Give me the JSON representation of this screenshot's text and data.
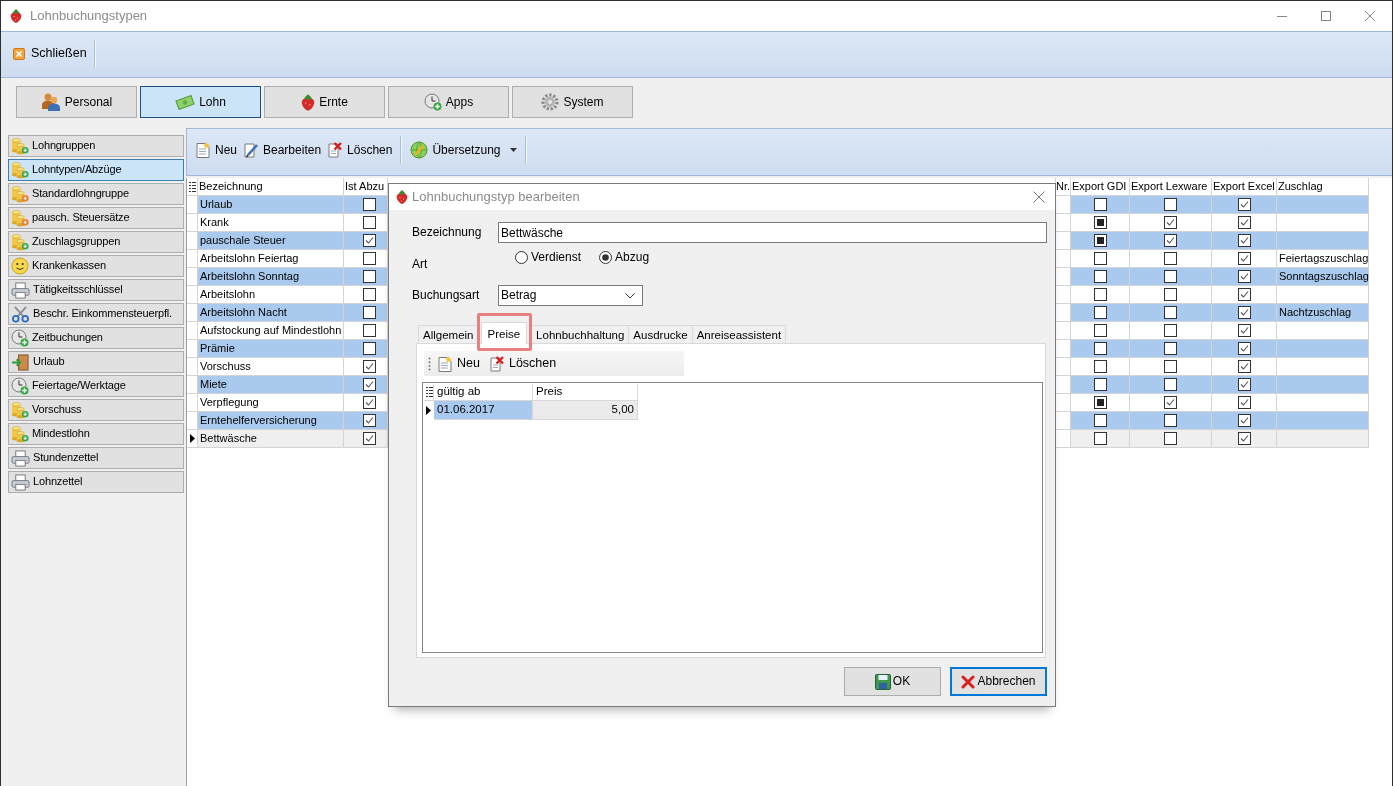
{
  "window": {
    "title": "Lohnbuchungstypen"
  },
  "toolbar": {
    "buttons": [
      {
        "label": "Schließen"
      }
    ]
  },
  "modules": [
    {
      "label": "Personal",
      "selected": false
    },
    {
      "label": "Lohn",
      "selected": true
    },
    {
      "label": "Ernte",
      "selected": false
    },
    {
      "label": "Apps",
      "selected": false
    },
    {
      "label": "System",
      "selected": false
    }
  ],
  "sidebar": {
    "items": [
      {
        "label": "Lohngruppen",
        "selected": false
      },
      {
        "label": "Lohntypen/Abzüge",
        "selected": true
      },
      {
        "label": "Standardlohngruppe",
        "selected": false
      },
      {
        "label": "pausch. Steuersätze",
        "selected": false
      },
      {
        "label": "Zuschlagsgruppen",
        "selected": false
      },
      {
        "label": "Krankenkassen",
        "selected": false
      },
      {
        "label": "Tätigkeitsschlüssel",
        "selected": false
      },
      {
        "label": "Beschr. Einkommensteuerpfl.",
        "selected": false
      },
      {
        "label": "Zeitbuchungen",
        "selected": false
      },
      {
        "label": "Urlaub",
        "selected": false
      },
      {
        "label": "Feiertage/Werktage",
        "selected": false
      },
      {
        "label": "Vorschuss",
        "selected": false
      },
      {
        "label": "Mindestlohn",
        "selected": false
      },
      {
        "label": "Stundenzettel",
        "selected": false
      },
      {
        "label": "Lohnzettel",
        "selected": false
      }
    ]
  },
  "list_toolbar": {
    "buttons": [
      {
        "label": "Neu",
        "kind": "button"
      },
      {
        "label": "Bearbeiten",
        "kind": "button"
      },
      {
        "label": "Löschen",
        "kind": "button"
      },
      {
        "label": "Übersetzung",
        "kind": "dropdown"
      }
    ]
  },
  "table": {
    "columns": [
      "Bezeichnung",
      "Ist Abzu",
      "Nr.",
      "Export GDI",
      "Export Lexware",
      "Export Excel",
      "Zuschlag"
    ],
    "rows": [
      {
        "bezeichnung": "Urlaub",
        "ist_abzug": false,
        "export_gdi": false,
        "export_gdi_indeterminate": false,
        "export_lexware": false,
        "export_excel": true,
        "selected": false
      },
      {
        "bezeichnung": "Krank",
        "ist_abzug": false,
        "export_gdi": false,
        "export_gdi_indeterminate": true,
        "export_lexware": true,
        "export_excel": true,
        "selected": false
      },
      {
        "bezeichnung": "pauschale Steuer",
        "ist_abzug": true,
        "export_gdi": false,
        "export_gdi_indeterminate": true,
        "export_lexware": true,
        "export_excel": true,
        "selected": false
      },
      {
        "bezeichnung": "Arbeitslohn Feiertag",
        "ist_abzug": false,
        "export_gdi": false,
        "export_gdi_indeterminate": false,
        "export_lexware": false,
        "export_excel": true,
        "zuschlag": "Feiertagszuschlag",
        "selected": false
      },
      {
        "bezeichnung": "Arbeitslohn Sonntag",
        "ist_abzug": false,
        "export_gdi": false,
        "export_gdi_indeterminate": false,
        "export_lexware": false,
        "export_excel": true,
        "zuschlag": "Sonntagszuschlag",
        "selected": false
      },
      {
        "bezeichnung": "Arbeitslohn",
        "ist_abzug": false,
        "export_gdi": false,
        "export_gdi_indeterminate": false,
        "export_lexware": false,
        "export_excel": true,
        "selected": false
      },
      {
        "bezeichnung": "Arbeitslohn Nacht",
        "ist_abzug": false,
        "export_gdi": false,
        "export_gdi_indeterminate": false,
        "export_lexware": false,
        "export_excel": true,
        "zuschlag": "Nachtzuschlag",
        "selected": false
      },
      {
        "bezeichnung": "Aufstockung auf Mindestlohn",
        "ist_abzug": false,
        "export_gdi": false,
        "export_gdi_indeterminate": false,
        "export_lexware": false,
        "export_excel": true,
        "selected": false
      },
      {
        "bezeichnung": "Prämie",
        "ist_abzug": false,
        "export_gdi": false,
        "export_gdi_indeterminate": false,
        "export_lexware": false,
        "export_excel": true,
        "selected": false
      },
      {
        "bezeichnung": "Vorschuss",
        "ist_abzug": true,
        "export_gdi": false,
        "export_gdi_indeterminate": false,
        "export_lexware": false,
        "export_excel": true,
        "selected": false
      },
      {
        "bezeichnung": "Miete",
        "ist_abzug": true,
        "export_gdi": false,
        "export_gdi_indeterminate": false,
        "export_lexware": false,
        "export_excel": true,
        "selected": false
      },
      {
        "bezeichnung": "Verpflegung",
        "ist_abzug": true,
        "export_gdi": false,
        "export_gdi_indeterminate": true,
        "export_lexware": true,
        "export_excel": true,
        "selected": false
      },
      {
        "bezeichnung": "Erntehelferversicherung",
        "ist_abzug": true,
        "export_gdi": false,
        "export_gdi_indeterminate": false,
        "export_lexware": false,
        "export_excel": true,
        "selected": false
      },
      {
        "bezeichnung": "Bettwäsche",
        "ist_abzug": true,
        "export_gdi": false,
        "export_gdi_indeterminate": false,
        "export_lexware": false,
        "export_excel": true,
        "selected": true
      }
    ]
  },
  "dialog": {
    "title": "Lohnbuchungstyp bearbeiten",
    "bezeichnung": {
      "label": "Bezeichnung",
      "value": "Bettwäsche"
    },
    "art": {
      "label": "Art",
      "options": [
        {
          "label": "Verdienst",
          "selected": false
        },
        {
          "label": "Abzug",
          "selected": true
        }
      ]
    },
    "buchungsart": {
      "label": "Buchungsart",
      "value": "Betrag"
    },
    "tabs": [
      {
        "label": "Allgemein",
        "selected": false,
        "highlighted": false
      },
      {
        "label": "Preise",
        "selected": true,
        "highlighted": true
      },
      {
        "label": "Lohnbuchhaltung",
        "selected": false,
        "highlighted": false
      },
      {
        "label": "Ausdrucke",
        "selected": false,
        "highlighted": false
      },
      {
        "label": "Anreiseassistent",
        "selected": false,
        "highlighted": false
      }
    ],
    "prices_toolbar": {
      "buttons": [
        {
          "label": "Neu"
        },
        {
          "label": "Löschen"
        }
      ]
    },
    "prices_table": {
      "columns": [
        "gültig ab",
        "Preis"
      ],
      "rows": [
        {
          "gueltig_ab": "01.06.2017",
          "preis": "5,00",
          "selected": true
        }
      ]
    },
    "buttons": [
      {
        "label": "OK",
        "focused": false
      },
      {
        "label": "Abbrechen",
        "focused": true
      }
    ]
  }
}
